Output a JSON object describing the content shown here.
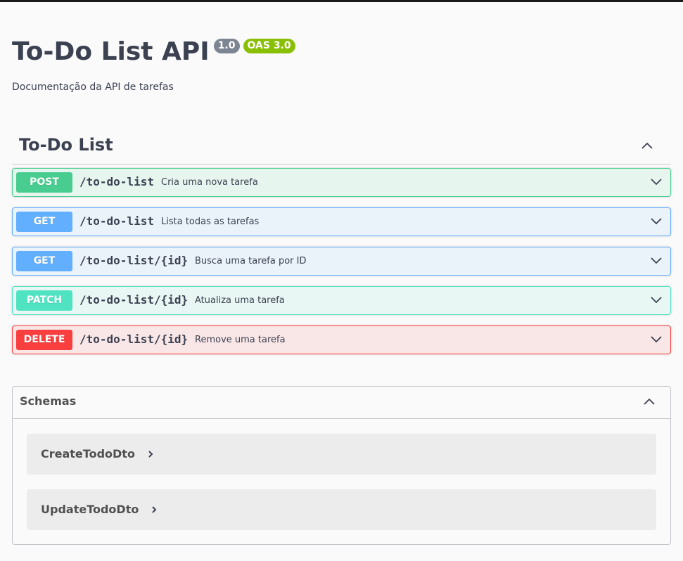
{
  "info": {
    "title": "To-Do List API",
    "version": "1.0",
    "oas": "OAS 3.0",
    "description": "Documentação da API de tarefas"
  },
  "tag": {
    "name": "To-Do List",
    "operations": [
      {
        "method": "POST",
        "path": "/to-do-list",
        "summary": "Cria uma nova tarefa"
      },
      {
        "method": "GET",
        "path": "/to-do-list",
        "summary": "Lista todas as tarefas"
      },
      {
        "method": "GET",
        "path": "/to-do-list/{id}",
        "summary": "Busca uma tarefa por ID"
      },
      {
        "method": "PATCH",
        "path": "/to-do-list/{id}",
        "summary": "Atualiza uma tarefa"
      },
      {
        "method": "DELETE",
        "path": "/to-do-list/{id}",
        "summary": "Remove uma tarefa"
      }
    ]
  },
  "schemas": {
    "title": "Schemas",
    "models": [
      {
        "name": "CreateTodoDto"
      },
      {
        "name": "UpdateTodoDto"
      }
    ]
  },
  "icons": {
    "collapse": "chevron-up-icon",
    "expand": "chevron-down-icon",
    "model_expand": "chevron-right-icon"
  },
  "colors": {
    "post": "#49cc90",
    "get": "#61affe",
    "patch": "#50e3c2",
    "delete": "#f93e3e",
    "version_badge": "#7d8492",
    "oas_badge": "#89bf04"
  }
}
